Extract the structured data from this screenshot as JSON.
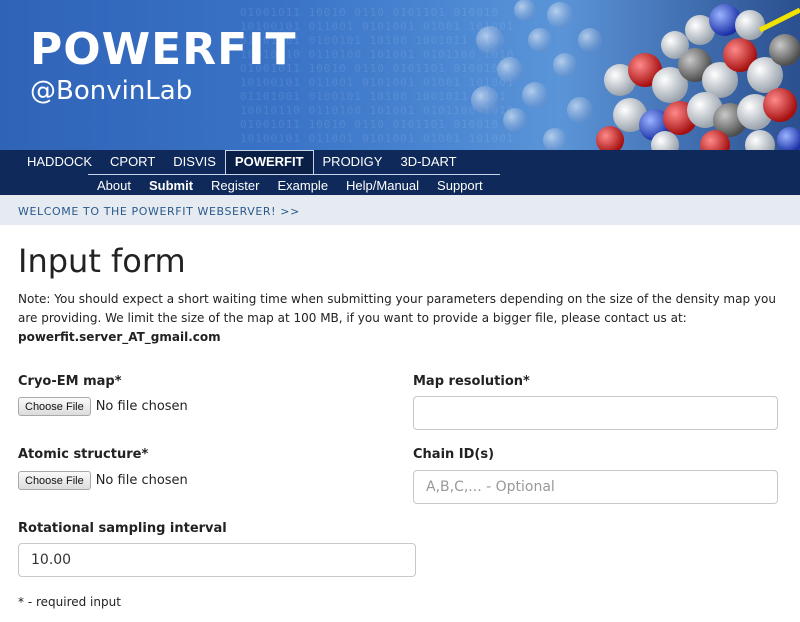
{
  "header": {
    "title": "POWERFIT",
    "subtitle": "@BonvinLab"
  },
  "nav": {
    "top": [
      "HADDOCK",
      "CPORT",
      "DISVIS",
      "POWERFIT",
      "PRODIGY",
      "3D-DART"
    ],
    "top_active": "POWERFIT",
    "sub": [
      "About",
      "Submit",
      "Register",
      "Example",
      "Help/Manual",
      "Support"
    ],
    "sub_active": "Submit"
  },
  "welcome": {
    "text": "WELCOME TO THE POWERFIT WEBSERVER! >>"
  },
  "form": {
    "title": "Input form",
    "note": "Note: You should expect a short waiting time when submitting your parameters depending on the size of the density map you are providing. We limit the size of the map at 100 MB, if you want to provide a bigger file, please contact us at:",
    "email": "powerfit.server_AT_gmail.com",
    "cryo_label": "Cryo-EM map*",
    "cryo_button": "Choose File",
    "cryo_status": "No file chosen",
    "map_res_label": "Map resolution*",
    "map_res_value": "",
    "atomic_label": "Atomic structure*",
    "atomic_button": "Choose File",
    "atomic_status": "No file chosen",
    "chain_label": "Chain ID(s)",
    "chain_placeholder": "A,B,C,... - Optional",
    "rot_label": "Rotational sampling interval",
    "rot_value": "10.00",
    "required_note": "* - required input"
  },
  "colors": {
    "banner_blue": "#3a73c6",
    "nav_navy": "#0f2a5a",
    "welcome_bg": "#e6eaf1",
    "link_blue": "#2a5a8c"
  }
}
